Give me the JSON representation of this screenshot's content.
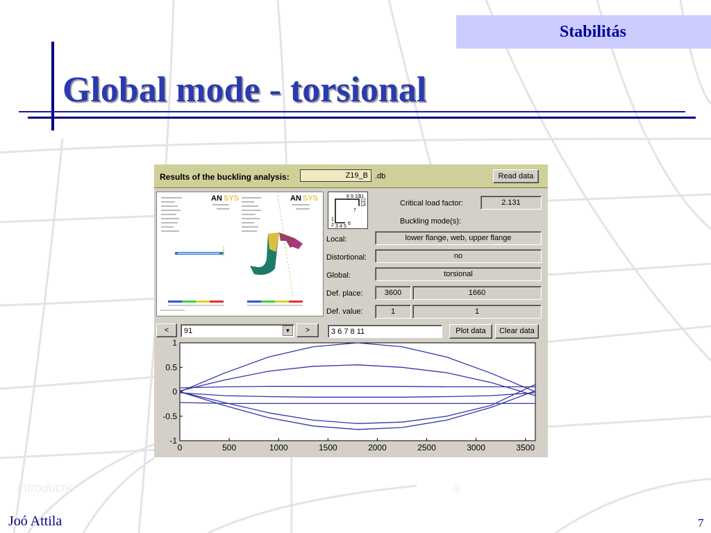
{
  "slide": {
    "corner_badge": "Stabilitás",
    "title": "Global mode - torsional",
    "author": "Joó Attila",
    "page_number": "7",
    "footer_left": "Introductio",
    "footer_right": "a"
  },
  "app": {
    "header": {
      "label": "Results of the buckling analysis:",
      "filename": "Z19_B",
      "extension": ".db",
      "read_button": "Read data"
    },
    "section_labels": [
      "8",
      "9",
      "10",
      "11",
      "12",
      "13",
      "7",
      "1",
      "2",
      "3",
      "4",
      "5",
      "6"
    ],
    "critical_load_label": "Critical load factor:",
    "critical_load_value": "2.131",
    "buckling_modes_label": "Buckling mode(s):",
    "local_label": "Local:",
    "local_value": "lower flange, web, upper flange",
    "distortional_label": "Distortional:",
    "distortional_value": "no",
    "global_label": "Global:",
    "global_value": "torsional",
    "def_place_label": "Def. place:",
    "def_place_1": "3600",
    "def_place_2": "1660",
    "def_value_label": "Def. value:",
    "def_value_1": "1",
    "def_value_2": "1",
    "prev_button": "<",
    "next_button": ">",
    "mode_select_value": "91",
    "dropdown_arrow": "▼",
    "nodes_input": "3 6 7 8 11",
    "plot_button": "Plot data",
    "clear_button": "Clear data",
    "ansys_logo": "ANSYS"
  },
  "chart_data": {
    "type": "line",
    "xlim": [
      0,
      3600
    ],
    "ylim": [
      -1,
      1
    ],
    "xticks": [
      "0",
      "500",
      "1000",
      "1500",
      "2000",
      "2500",
      "3000",
      "3500"
    ],
    "yticks": [
      "1",
      "0.5",
      "0",
      "-0.5",
      "-1"
    ],
    "color": "#3333aa",
    "series": [
      {
        "x": [
          0,
          450,
          900,
          1350,
          1800,
          2250,
          2700,
          3150,
          3600
        ],
        "y": [
          0,
          0.38,
          0.71,
          0.92,
          1.0,
          0.92,
          0.71,
          0.38,
          0
        ]
      },
      {
        "x": [
          0,
          450,
          900,
          1350,
          1800,
          2250,
          2700,
          3150,
          3600
        ],
        "y": [
          0.02,
          0.24,
          0.42,
          0.52,
          0.55,
          0.5,
          0.39,
          0.19,
          -0.08
        ]
      },
      {
        "x": [
          0,
          450,
          900,
          1350,
          1800,
          2250,
          2700,
          3150,
          3600
        ],
        "y": [
          0.08,
          0.1,
          0.11,
          0.11,
          0.11,
          0.11,
          0.1,
          0.1,
          0.1
        ]
      },
      {
        "x": [
          0,
          450,
          900,
          1350,
          1800,
          2250,
          2700,
          3150,
          3600
        ],
        "y": [
          -0.02,
          -0.08,
          -0.1,
          -0.11,
          -0.11,
          -0.11,
          -0.1,
          -0.08,
          -0.02
        ]
      },
      {
        "x": [
          0,
          450,
          900,
          1350,
          1800,
          2250,
          2700,
          3150,
          3600
        ],
        "y": [
          -0.22,
          -0.24,
          -0.24,
          -0.24,
          -0.24,
          -0.24,
          -0.24,
          -0.24,
          -0.24
        ]
      },
      {
        "x": [
          0,
          450,
          900,
          1350,
          1800,
          2250,
          2700,
          3150,
          3600
        ],
        "y": [
          0,
          -0.22,
          -0.43,
          -0.58,
          -0.65,
          -0.62,
          -0.5,
          -0.28,
          0.15
        ]
      },
      {
        "x": [
          0,
          450,
          900,
          1350,
          1800,
          2250,
          2700,
          3150,
          3600
        ],
        "y": [
          0,
          -0.28,
          -0.53,
          -0.7,
          -0.77,
          -0.73,
          -0.58,
          -0.32,
          0.02
        ]
      }
    ]
  }
}
